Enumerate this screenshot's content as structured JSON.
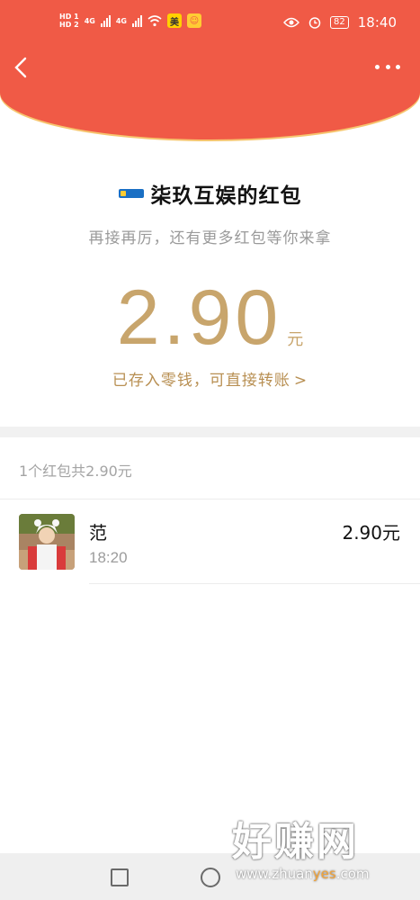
{
  "status_bar": {
    "network_badges": [
      "HD 1",
      "HD 2"
    ],
    "network_types": [
      "4G",
      "4G"
    ],
    "app_icons": [
      "meituan-icon",
      "message-app-icon"
    ],
    "battery": "82",
    "time": "18:40"
  },
  "header": {
    "back_icon": "chevron-left-icon",
    "more_icon": "more-dots-icon"
  },
  "packet": {
    "brand_logo": "qijiu-logo",
    "title": "柒玖互娱的红包",
    "subtitle": "再接再厉，还有更多红包等你来拿",
    "amount": "2.90",
    "unit": "元",
    "saved_link": "已存入零钱，可直接转账",
    "chevron": ">"
  },
  "summary": "1个红包共2.90元",
  "receivers": [
    {
      "name": "范",
      "time": "18:20",
      "amount": "2.90元"
    }
  ],
  "watermark": {
    "title": "好赚网",
    "url_prefix": "www.zhuan",
    "url_highlight": "yes",
    "url_suffix": ".com"
  },
  "colors": {
    "header_red": "#f05a46",
    "gold": "#c8a56c"
  }
}
